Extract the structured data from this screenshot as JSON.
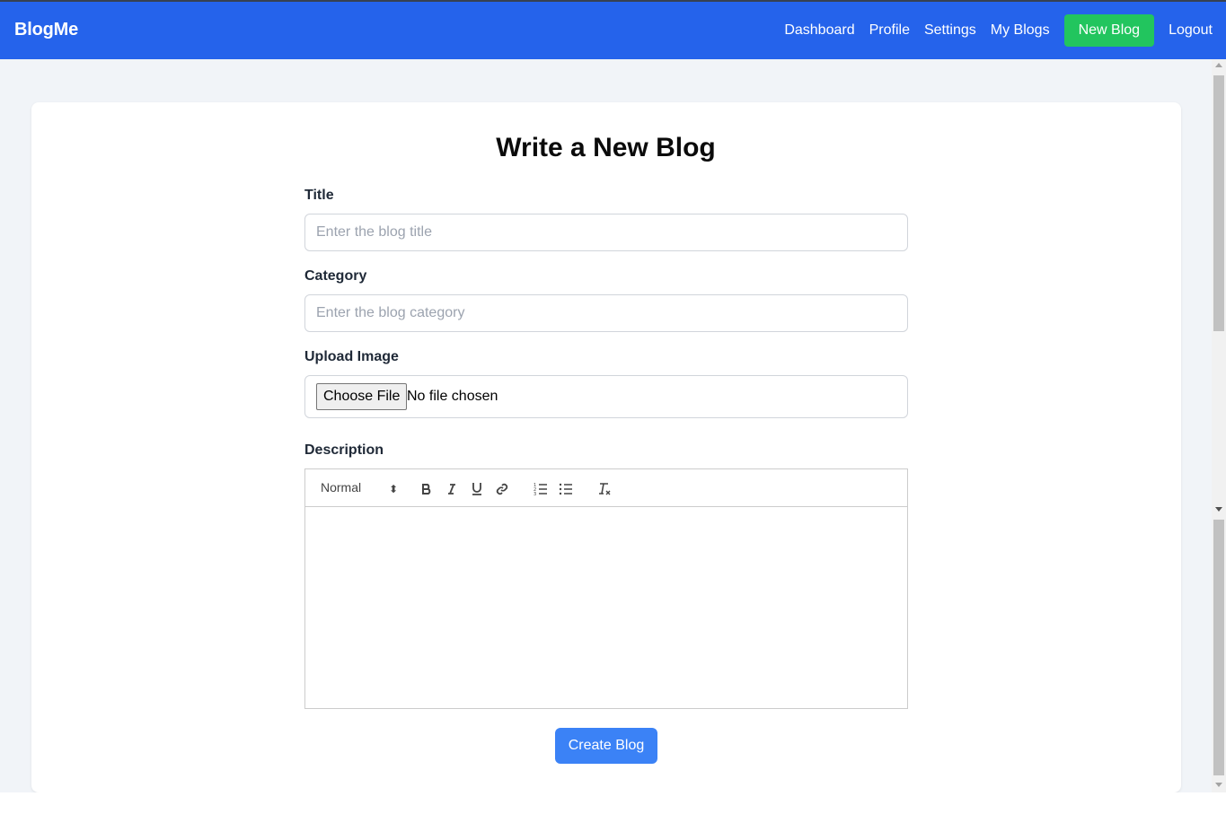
{
  "navbar": {
    "brand": "BlogMe",
    "links": [
      "Dashboard",
      "Profile",
      "Settings",
      "My Blogs"
    ],
    "new_blog": "New Blog",
    "logout": "Logout",
    "color": "#2563eb",
    "accent": "#22c55e"
  },
  "form": {
    "heading": "Write a New Blog",
    "title_label": "Title",
    "title_placeholder": "Enter the blog title",
    "category_label": "Category",
    "category_placeholder": "Enter the blog category",
    "image_label": "Upload Image",
    "choose_file": "Choose File",
    "file_status": "No file chosen",
    "description_label": "Description",
    "editor": {
      "format_select": "Normal",
      "toolbar_icons": [
        "bold-icon",
        "italic-icon",
        "underline-icon",
        "link-icon",
        "ordered-list-icon",
        "bullet-list-icon",
        "clear-format-icon"
      ]
    },
    "submit": "Create Blog",
    "submit_color": "#3b82f6"
  }
}
